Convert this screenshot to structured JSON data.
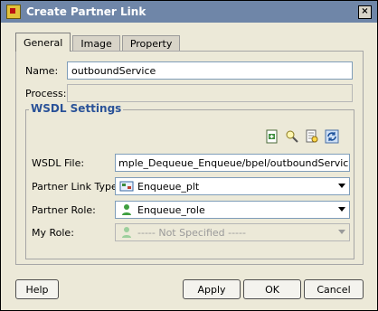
{
  "dialog": {
    "title": "Create Partner Link",
    "close_glyph": "×",
    "icon": "partner-link-app-icon"
  },
  "tabs": [
    {
      "label": "General",
      "active": true
    },
    {
      "label": "Image",
      "active": false
    },
    {
      "label": "Property",
      "active": false
    }
  ],
  "form": {
    "name_label": "Name:",
    "name_value": "outboundService",
    "process_label": "Process:",
    "process_value": ""
  },
  "wsdl": {
    "group_title": "WSDL Settings",
    "toolbar_icons": [
      "add-wsdl-icon",
      "find-icon",
      "browse-icon",
      "refresh-icon"
    ],
    "wsdl_file_label": "WSDL File:",
    "wsdl_file_value": "mple_Dequeue_Enqueue/bpel/outboundService.wsdl",
    "partner_link_type_label": "Partner Link Type:",
    "partner_link_type_value": "Enqueue_plt",
    "partner_role_label": "Partner Role:",
    "partner_role_value": "Enqueue_role",
    "my_role_label": "My Role:",
    "my_role_value": "----- Not Specified -----"
  },
  "buttons": {
    "help": "Help",
    "apply": "Apply",
    "ok": "OK",
    "cancel": "Cancel"
  },
  "colors": {
    "titlebar": "#6f86a8",
    "group_title": "#2a5298",
    "window_bg": "#ece9d8"
  }
}
